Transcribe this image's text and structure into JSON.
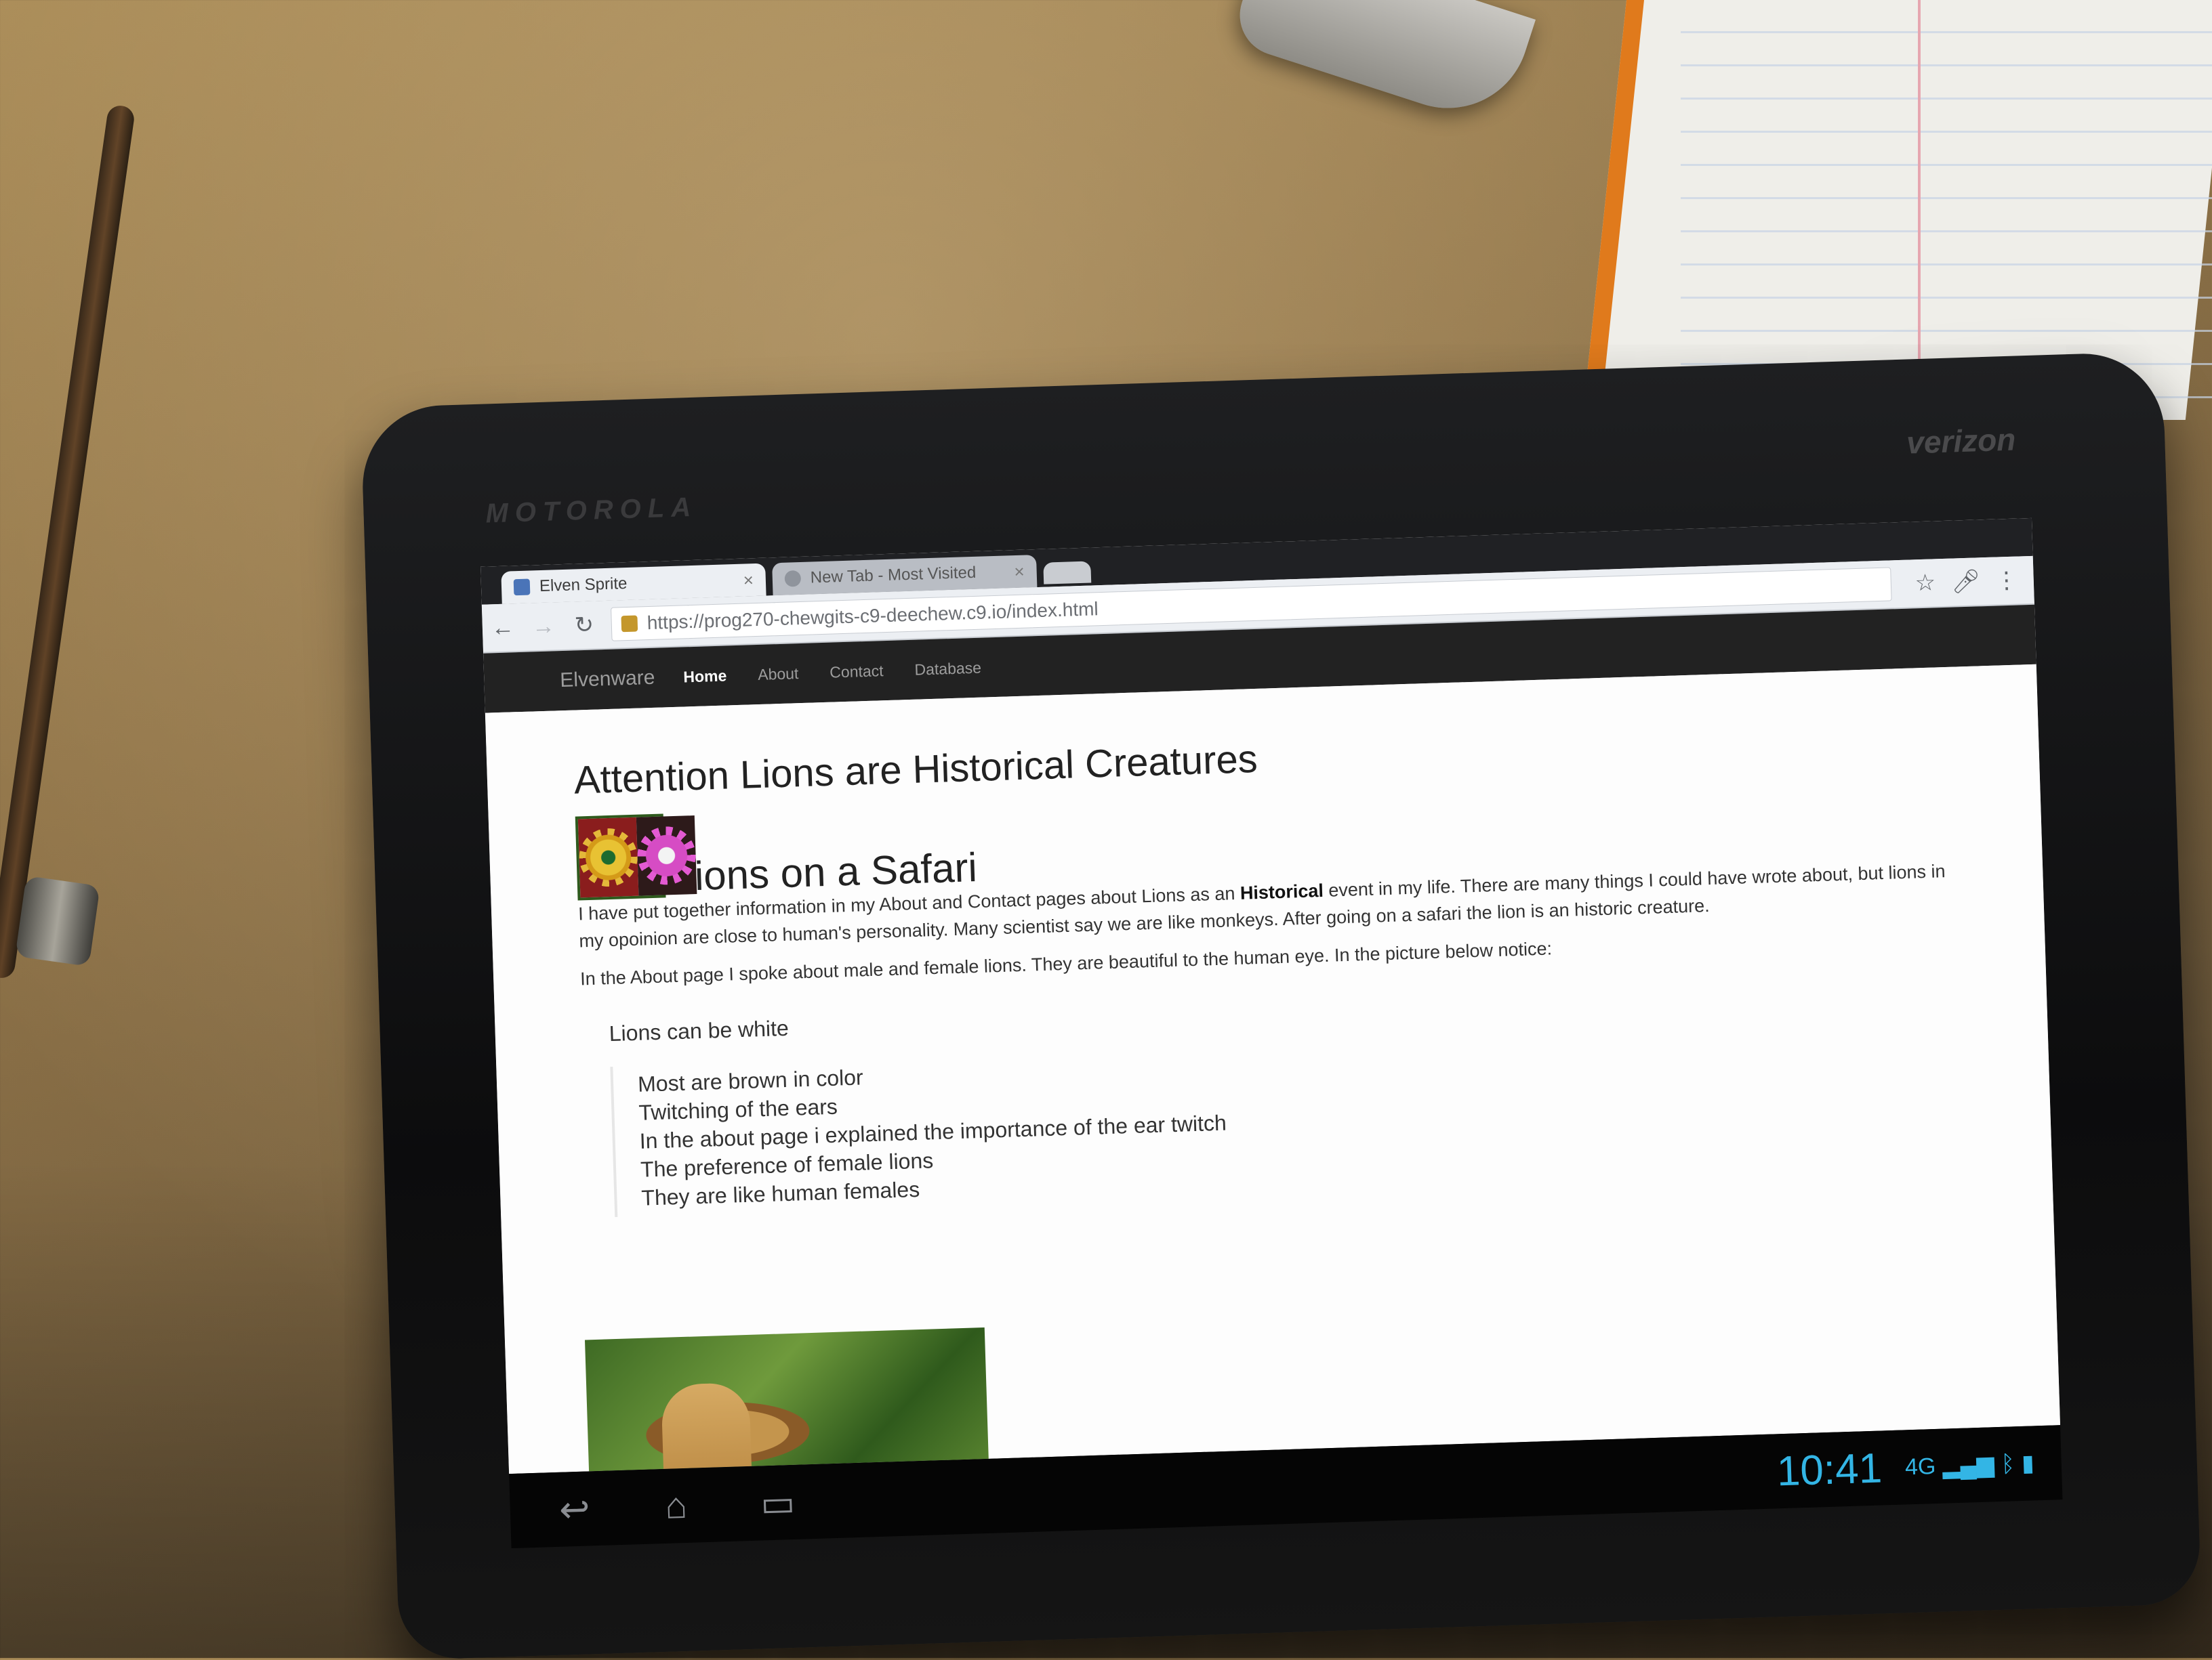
{
  "browser": {
    "tabs": [
      {
        "label": "Elven Sprite",
        "active": true
      },
      {
        "label": "New Tab - Most Visited",
        "active": false
      }
    ],
    "url": "https://prog270-chewgits-c9-deechew.c9.io/index.html",
    "icons": {
      "back": "back-arrow-icon",
      "forward": "forward-arrow-icon",
      "reload": "reload-icon",
      "star": "star-icon",
      "mic": "microphone-icon",
      "menu": "menu-icon"
    }
  },
  "navbar": {
    "brand": "Elvenware",
    "links": [
      "Home",
      "About",
      "Contact",
      "Database"
    ],
    "active": "Home"
  },
  "content": {
    "heading": "Attention Lions are Historical Creatures",
    "subheading": "Lions on a Safari",
    "paragraph1_a": "I have put together information in my About and Contact pages about Lions as an ",
    "paragraph1_bold": "Historical",
    "paragraph1_b": " event in my life. There are many things I could have wrote about, but lions in my opoinion are close to human's personality. Many scientist say we are like monkeys. After going on a safari the lion is an historic creature.",
    "paragraph2": "In the About page I spoke about male and female lions. They are beautiful to the human eye. In the picture below notice:",
    "list_heading": "Lions can be white",
    "list": [
      "Most are brown in color",
      "Twitching of the ears",
      "In the about page i explained the importance of the ear twitch",
      "The preference of female lions",
      "They are like human females"
    ]
  },
  "device": {
    "brand": "MOTOROLA",
    "carrier": "verizon",
    "clock": "10:41",
    "network": "4G",
    "accent": "#33b5e5"
  }
}
